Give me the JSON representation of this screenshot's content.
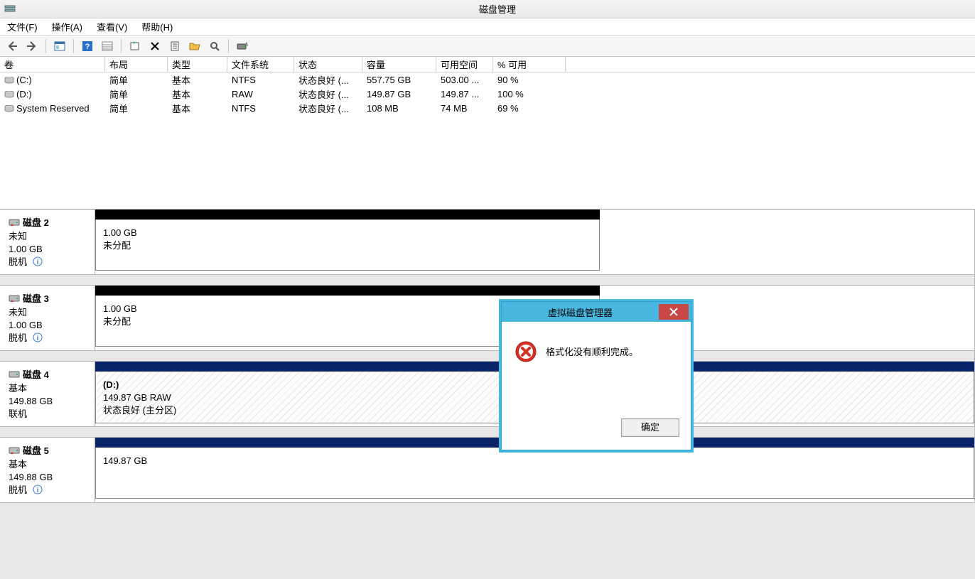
{
  "window": {
    "title": "磁盘管理"
  },
  "menu": {
    "file": "文件(F)",
    "action": "操作(A)",
    "view": "查看(V)",
    "help": "帮助(H)"
  },
  "columns": {
    "volume": "卷",
    "layout": "布局",
    "type": "类型",
    "fs": "文件系统",
    "status": "状态",
    "capacity": "容量",
    "free": "可用空间",
    "pct": "% 可用"
  },
  "volumes": [
    {
      "name": "(C:)",
      "layout": "简单",
      "type": "基本",
      "fs": "NTFS",
      "status": "状态良好 (...",
      "capacity": "557.75 GB",
      "free": "503.00 ...",
      "pct": "90 %"
    },
    {
      "name": "(D:)",
      "layout": "简单",
      "type": "基本",
      "fs": "RAW",
      "status": "状态良好 (...",
      "capacity": "149.87 GB",
      "free": "149.87 ...",
      "pct": "100 %"
    },
    {
      "name": "System Reserved",
      "layout": "简单",
      "type": "基本",
      "fs": "NTFS",
      "status": "状态良好 (...",
      "capacity": "108 MB",
      "free": "74 MB",
      "pct": "69 %"
    }
  ],
  "disks": [
    {
      "name": "磁盘 2",
      "status": "未知",
      "size": "1.00 GB",
      "conn": "脱机",
      "narrow": true,
      "bar": "black",
      "part": {
        "title": "",
        "size": "1.00 GB",
        "extra": "未分配",
        "hatch": false
      }
    },
    {
      "name": "磁盘 3",
      "status": "未知",
      "size": "1.00 GB",
      "conn": "脱机",
      "narrow": true,
      "bar": "black",
      "part": {
        "title": "",
        "size": "1.00 GB",
        "extra": "未分配",
        "hatch": false
      }
    },
    {
      "name": "磁盘 4",
      "status": "基本",
      "size": "149.88 GB",
      "conn": "联机",
      "narrow": false,
      "bar": "blue",
      "part": {
        "title": "(D:)",
        "size": "149.87 GB RAW",
        "extra": "状态良好 (主分区)",
        "hatch": true
      }
    },
    {
      "name": "磁盘 5",
      "status": "基本",
      "size": "149.88 GB",
      "conn": "脱机",
      "narrow": false,
      "bar": "blue",
      "part": {
        "title": "",
        "size": "149.87 GB",
        "extra": "",
        "hatch": false
      }
    }
  ],
  "dialog": {
    "title": "虚拟磁盘管理器",
    "message": "格式化没有顺利完成。",
    "ok": "确定"
  }
}
